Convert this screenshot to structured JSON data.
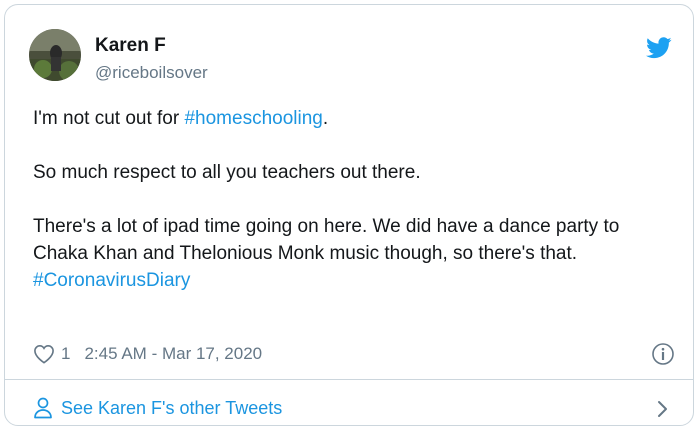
{
  "tweet": {
    "author_name": "Karen F",
    "author_handle": "@riceboilsover",
    "line1_prefix": "I'm not cut out for ",
    "line1_hashtag": "#homeschooling",
    "line1_suffix": ".",
    "paragraph2": "So much respect to all you teachers out there.",
    "paragraph3_text": "There's a lot of ipad time going on here. We did have a dance party to Chaka Khan and Thelonious Monk music though, so there's that. ",
    "paragraph3_hashtag": "#CoronavirusDiary",
    "like_count": "1",
    "timestamp": "2:45 AM - Mar 17, 2020"
  },
  "footer": {
    "see_more_label": "See Karen F's other Tweets"
  },
  "colors": {
    "link": "#1b95e0",
    "text": "#14171a",
    "muted": "#657786",
    "border": "#ccd6dd",
    "twitter_blue": "#1da1f2"
  },
  "icons": [
    "avatar-photo",
    "twitter-bird-icon",
    "heart-icon",
    "info-icon",
    "person-icon",
    "chevron-right-icon"
  ]
}
